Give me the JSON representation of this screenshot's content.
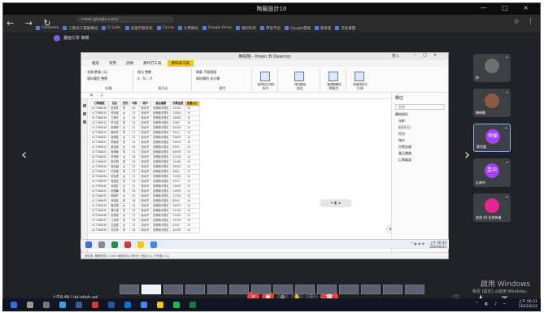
{
  "window": {
    "title": "陶藝設計10",
    "controls": "— □ ×"
  },
  "browser": {
    "address": "meet.google.com/",
    "bookmarks": [
      "Facebook",
      "三重商工電腦專班",
      "G Suite",
      "高雄市教育局",
      "Canva",
      "大學網站",
      "Google Drive",
      "資訊科目",
      "學習平台",
      "Google雲端",
      "教育部",
      "其他書籤"
    ],
    "nav_icons": "← → ↻"
  },
  "meet": {
    "header_title": "畫面分享 簡報",
    "time": "上午6:44",
    "meeting_code": "lat-ubuh-upi",
    "participants": [
      {
        "name": "你",
        "avatar_color": "#6f6f6f",
        "initial": ""
      },
      {
        "name": "陳新龍",
        "avatar_color": "#8a5a44",
        "initial": ""
      },
      {
        "name": "蔡世榮",
        "avatar_color": "#a142f4",
        "initial": "世榮"
      },
      {
        "name": "丸新中",
        "avatar_color": "#a142f4",
        "initial": "昱中"
      },
      {
        "name": "其他 40 位參與者",
        "avatar_color": "#e52592",
        "initial": ""
      }
    ]
  },
  "pbi": {
    "title": "無標題 - Power BI Desktop",
    "user": "登入",
    "tabs": [
      "檔案",
      "常用",
      "說明",
      "資料行工具",
      "資料表工具"
    ],
    "ribbon": {
      "name_label": "名稱",
      "name_value": "數量 (元)",
      "datatype_label": "資料類型",
      "datatype_value": "整數",
      "format_label": "格式",
      "format_value": "整數",
      "structure": "結構",
      "formatting": "格式化",
      "summary_label": "摘要",
      "summary_value": "不要摘要",
      "category_label": "資料類別",
      "category_value": "未分類",
      "properties": "屬性",
      "sort_label": "依資料行排序",
      "groups_label": "資料群組",
      "manage_rel": "管理關聯性",
      "new_col": "新增資料行",
      "sort_section": "排序",
      "groups_section": "群組",
      "rel_section": "關聯性",
      "calc_section": "計算"
    },
    "formula_marks": "✕ ✓",
    "columns": [
      "訂單編號",
      "姓名",
      "性別",
      "年齡",
      "城市",
      "產品種類",
      "消費金額",
      "數量(元)",
      "折扣"
    ],
    "rows": [
      [
        "A17788814",
        "張俊年",
        "男",
        "26",
        "新北市",
        "皮飾與手提包",
        "12050",
        "10"
      ],
      [
        "A17788815",
        "林淑惠",
        "女",
        "23",
        "新北市",
        "皮飾與手提包",
        "22820",
        "10"
      ],
      [
        "A17788816",
        "王美珍",
        "女",
        "29",
        "新北市",
        "皮飾與手提包",
        "18940",
        "10"
      ],
      [
        "A17788817",
        "李志豪",
        "男",
        "31",
        "新北市",
        "皮飾與手提包",
        "5060",
        "10"
      ],
      [
        "A17788818",
        "張雅婷",
        "女",
        "25",
        "新北市",
        "皮飾與手提包",
        "28450",
        "10"
      ],
      [
        "A17788819",
        "陳冠宇",
        "男",
        "27",
        "新北市",
        "皮飾與手提包",
        "3210",
        "10"
      ],
      [
        "A17788820",
        "吳佩君",
        "女",
        "30",
        "新北市",
        "皮飾與手提包",
        "14600",
        "10"
      ],
      [
        "A17788821",
        "劉家豪",
        "男",
        "24",
        "新北市",
        "皮飾與手提包",
        "24900",
        "10"
      ],
      [
        "A17788822",
        "蔡宜蓁",
        "女",
        "28",
        "新北市",
        "皮飾與手提包",
        "9300",
        "10"
      ],
      [
        "A17788823",
        "楊承翰",
        "男",
        "32",
        "新北市",
        "皮飾與手提包",
        "46500",
        "10"
      ],
      [
        "A17788824",
        "許雅琪",
        "女",
        "26",
        "新北市",
        "皮飾與手提包",
        "22100",
        "10"
      ],
      [
        "A17788825",
        "鄭志明",
        "男",
        "29",
        "新北市",
        "皮飾與手提包",
        "15060",
        "10"
      ],
      [
        "A17788826",
        "謝佳穎",
        "女",
        "22",
        "新北市",
        "皮飾與手提包",
        "28900",
        "10"
      ],
      [
        "A17788827",
        "洪俊傑",
        "男",
        "33",
        "新北市",
        "皮飾與手提包",
        "4660",
        "10"
      ],
      [
        "A17788828",
        "郭怡君",
        "女",
        "27",
        "新北市",
        "皮飾與手提包",
        "31500",
        "10"
      ],
      [
        "A17788829",
        "曾建宏",
        "男",
        "25",
        "新北市",
        "皮飾與手提包",
        "2400",
        "10"
      ],
      [
        "A17788830",
        "邱淑芬",
        "女",
        "31",
        "新北市",
        "皮飾與手提包",
        "19800",
        "10"
      ],
      [
        "A17788831",
        "廖國華",
        "男",
        "28",
        "新北市",
        "皮飾與手提包",
        "24600",
        "10"
      ],
      [
        "A17788832",
        "賴美玲",
        "女",
        "30",
        "新北市",
        "皮飾與手提包",
        "11250",
        "10"
      ],
      [
        "A17788833",
        "周冠廷",
        "男",
        "26",
        "新北市",
        "皮飾與手提包",
        "8000",
        "10"
      ],
      [
        "A17788834",
        "葉佳蓉",
        "女",
        "24",
        "新北市",
        "皮飾與手提包",
        "16870",
        "10"
      ],
      [
        "A17788835",
        "蘇文傑",
        "男",
        "29",
        "新北市",
        "皮飾與手提包",
        "22030",
        "10"
      ],
      [
        "A17788836",
        "莊雅雯",
        "女",
        "27",
        "新北市",
        "皮飾與手提包",
        "13900",
        "10"
      ],
      [
        "A17788837",
        "江俊男",
        "男",
        "32",
        "新北市",
        "皮飾與手提包",
        "29750",
        "10"
      ],
      [
        "A17788838",
        "呂宜庭",
        "女",
        "23",
        "新北市",
        "皮飾與手提包",
        "6100",
        "10"
      ],
      [
        "A17788839",
        "何志偉",
        "男",
        "28",
        "新北市",
        "皮飾與手提包",
        "40450",
        "10"
      ]
    ],
    "fields_title": "欄位",
    "search_placeholder": "搜尋",
    "fields": [
      "購物資料",
      "年齡",
      "折扣(元)",
      "性別",
      "城市",
      "消費金額",
      "產品種類",
      "訂單編號"
    ],
    "status": "資料表: 購物資料 (1,000 個資料列) 資料行: 數量(元) (不同值: 21)",
    "inner_clock_time": "上午 06:44",
    "inner_clock_date": "2022/8/22"
  },
  "windows": {
    "activate_title": "啟用 Windows",
    "activate_sub": "移至 [設定] 以啟用 Windows。",
    "clock_time": "上午 06:31",
    "clock_date": "2022/8/22"
  }
}
